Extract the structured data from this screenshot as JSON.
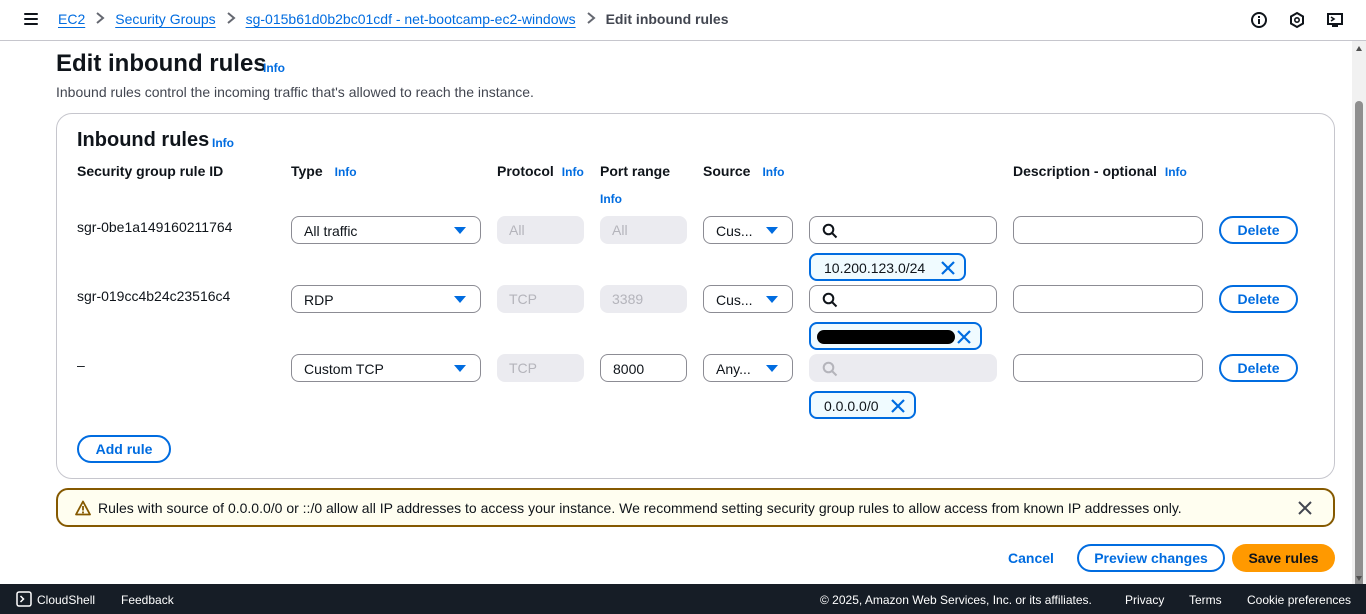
{
  "breadcrumb": {
    "items": [
      "EC2",
      "Security Groups",
      "sg-015b61d0b2bc01cdf - net-bootcamp-ec2-windows"
    ],
    "current": "Edit inbound rules"
  },
  "header": {
    "title": "Edit inbound rules",
    "info": "Info",
    "description": "Inbound rules control the incoming traffic that's allowed to reach the instance."
  },
  "section": {
    "title": "Inbound rules",
    "info": "Info",
    "columns": {
      "rule_id": "Security group rule ID",
      "type": "Type",
      "protocol": "Protocol",
      "port_range": "Port range",
      "source": "Source",
      "description": "Description - optional",
      "info": "Info"
    },
    "rules": [
      {
        "id": "sgr-0be1a149160211764",
        "type": "All traffic",
        "protocol": "All",
        "port": "All",
        "source": "Cus...",
        "token": "10.200.123.0/24",
        "delete": "Delete"
      },
      {
        "id": "sgr-019cc4b24c23516c4",
        "type": "RDP",
        "protocol": "TCP",
        "port": "3389",
        "source": "Cus...",
        "token": "",
        "delete": "Delete"
      },
      {
        "id": "–",
        "type": "Custom TCP",
        "protocol": "TCP",
        "port": "8000",
        "source": "Any...",
        "token": "0.0.0.0/0",
        "delete": "Delete"
      }
    ],
    "add_rule": "Add rule"
  },
  "warning": {
    "text": "Rules with source of 0.0.0.0/0 or ::/0 allow all IP addresses to access your instance. We recommend setting security group rules to allow access from known IP addresses only."
  },
  "actions": {
    "cancel": "Cancel",
    "preview": "Preview changes",
    "save": "Save rules"
  },
  "footer": {
    "cloudshell": "CloudShell",
    "feedback": "Feedback",
    "copyright": "© 2025, Amazon Web Services, Inc. or its affiliates.",
    "privacy": "Privacy",
    "terms": "Terms",
    "cookies": "Cookie preferences"
  },
  "icons": {
    "menu": "hamburger-menu-icon",
    "info": "info-circle-icon",
    "notifications": "notification-icon",
    "settings": "console-settings-icon",
    "search": "search-icon",
    "remove": "close-icon",
    "warning": "warning-triangle-icon",
    "caret": "caret-down-icon"
  },
  "colors": {
    "link": "#006ce0",
    "primary": "#ff9900",
    "warning_border": "#855900",
    "footer_bg": "#161d26"
  }
}
